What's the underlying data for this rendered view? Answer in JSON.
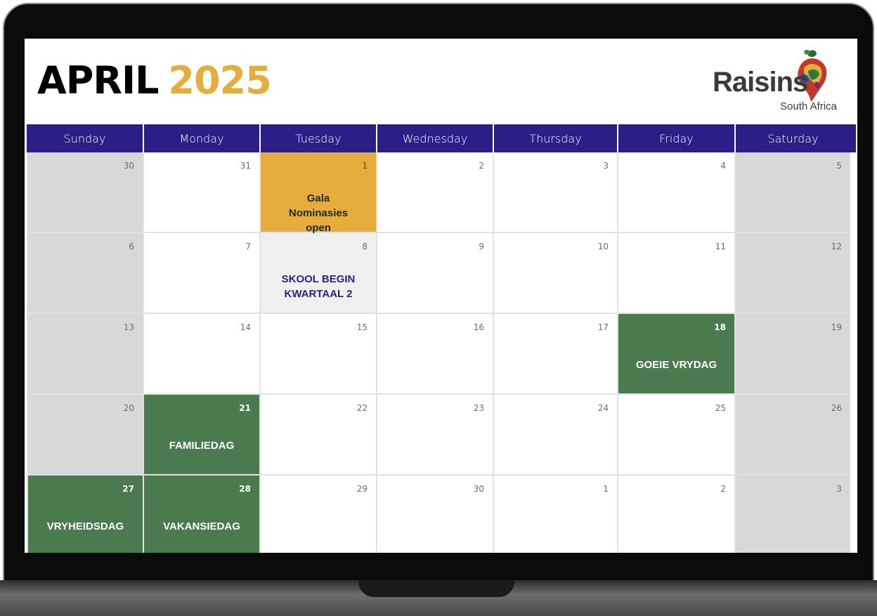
{
  "header": {
    "month": "APRIL",
    "year": "2025",
    "logo_word": "Raisins",
    "logo_sub": "South Africa"
  },
  "weekdays": [
    "Sunday",
    "Monday",
    "Tuesday",
    "Wednesday",
    "Thursday",
    "Friday",
    "Saturday"
  ],
  "weeks": [
    [
      {
        "day": "30",
        "style": "weekend",
        "event": ""
      },
      {
        "day": "31",
        "style": "",
        "event": ""
      },
      {
        "day": "1",
        "style": "gold",
        "event": "Gala Nominasies open"
      },
      {
        "day": "2",
        "style": "",
        "event": ""
      },
      {
        "day": "3",
        "style": "",
        "event": ""
      },
      {
        "day": "4",
        "style": "",
        "event": ""
      },
      {
        "day": "5",
        "style": "weekend",
        "event": ""
      }
    ],
    [
      {
        "day": "6",
        "style": "weekend",
        "event": ""
      },
      {
        "day": "7",
        "style": "",
        "event": ""
      },
      {
        "day": "8",
        "style": "grey",
        "event": "SKOOL BEGIN KWARTAAL 2"
      },
      {
        "day": "9",
        "style": "",
        "event": ""
      },
      {
        "day": "10",
        "style": "",
        "event": ""
      },
      {
        "day": "11",
        "style": "",
        "event": ""
      },
      {
        "day": "12",
        "style": "weekend",
        "event": ""
      }
    ],
    [
      {
        "day": "13",
        "style": "weekend",
        "event": ""
      },
      {
        "day": "14",
        "style": "",
        "event": ""
      },
      {
        "day": "15",
        "style": "",
        "event": ""
      },
      {
        "day": "16",
        "style": "",
        "event": ""
      },
      {
        "day": "17",
        "style": "",
        "event": ""
      },
      {
        "day": "18",
        "style": "green",
        "event": "GOEIE VRYDAG"
      },
      {
        "day": "19",
        "style": "weekend",
        "event": ""
      }
    ],
    [
      {
        "day": "20",
        "style": "weekend",
        "event": ""
      },
      {
        "day": "21",
        "style": "green",
        "event": "FAMILIEDAG"
      },
      {
        "day": "22",
        "style": "",
        "event": ""
      },
      {
        "day": "23",
        "style": "",
        "event": ""
      },
      {
        "day": "24",
        "style": "",
        "event": ""
      },
      {
        "day": "25",
        "style": "",
        "event": ""
      },
      {
        "day": "26",
        "style": "weekend",
        "event": ""
      }
    ],
    [
      {
        "day": "27",
        "style": "green",
        "event": "VRYHEIDSDAG"
      },
      {
        "day": "28",
        "style": "green",
        "event": "VAKANSIEDAG"
      },
      {
        "day": "29",
        "style": "",
        "event": ""
      },
      {
        "day": "30",
        "style": "",
        "event": ""
      },
      {
        "day": "1",
        "style": "",
        "event": ""
      },
      {
        "day": "2",
        "style": "",
        "event": ""
      },
      {
        "day": "3",
        "style": "weekend",
        "event": ""
      }
    ]
  ],
  "colors": {
    "header_bar": "#2b1f87",
    "year": "#e6ad3c",
    "holiday": "#4a7a4e",
    "weekend": "#d8d8d8"
  }
}
